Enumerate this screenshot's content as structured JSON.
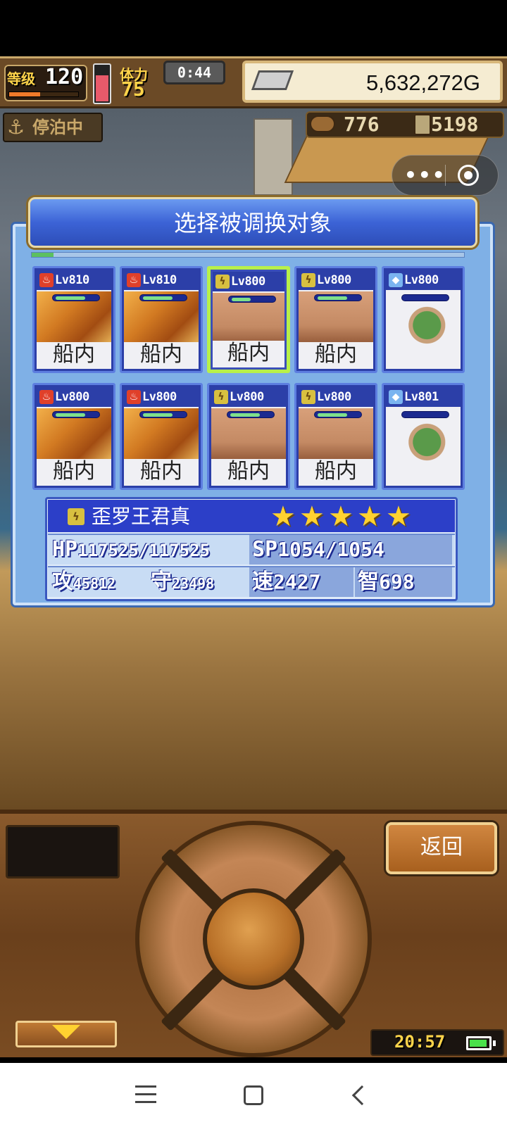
{
  "hud": {
    "level_label": "等级",
    "level_value": "120",
    "exp_fraction": 0.45,
    "stamina_label": "体力",
    "stamina_value": "75",
    "stamina_fraction": 0.85,
    "timer": "0:44",
    "gold": "5,632,272G",
    "moored_label": "停泊中",
    "wood_value": "776",
    "ore_value": "5198"
  },
  "dialog": {
    "title": "选择被调换对象",
    "progress_fraction": 0.05
  },
  "cards": [
    {
      "element": "fire",
      "level": "Lv810",
      "portrait": "dragon",
      "hp_fraction": 0.7,
      "label": "船内",
      "selected": false
    },
    {
      "element": "fire",
      "level": "Lv810",
      "portrait": "dragon",
      "hp_fraction": 0.7,
      "label": "船内",
      "selected": false
    },
    {
      "element": "thunder",
      "level": "Lv800",
      "portrait": "golem",
      "hp_fraction": 0.45,
      "label": "船内",
      "selected": true
    },
    {
      "element": "thunder",
      "level": "Lv800",
      "portrait": "golem",
      "hp_fraction": 0.7,
      "label": "船内",
      "selected": false
    },
    {
      "element": "water",
      "level": "Lv800",
      "portrait": "crab",
      "hp_fraction": 0.0,
      "label": "",
      "selected": false
    },
    {
      "element": "fire",
      "level": "Lv800",
      "portrait": "dragon",
      "hp_fraction": 0.7,
      "label": "船内",
      "selected": false
    },
    {
      "element": "fire",
      "level": "Lv800",
      "portrait": "dragon",
      "hp_fraction": 0.7,
      "label": "船内",
      "selected": false
    },
    {
      "element": "thunder",
      "level": "Lv800",
      "portrait": "golem",
      "hp_fraction": 0.7,
      "label": "船内",
      "selected": false
    },
    {
      "element": "thunder",
      "level": "Lv800",
      "portrait": "golem",
      "hp_fraction": 0.7,
      "label": "船内",
      "selected": false
    },
    {
      "element": "water",
      "level": "Lv801",
      "portrait": "crab",
      "hp_fraction": 0.0,
      "label": "",
      "selected": false
    }
  ],
  "unit": {
    "name": "歪罗王君真",
    "element": "thunder",
    "stars": 5,
    "hp_label": "HP",
    "hp_value": "117525/117525",
    "sp_label": "SP",
    "sp_value": "1054/1054",
    "atk_label": "攻",
    "atk_value": "45812",
    "def_label": "守",
    "def_value": "23498",
    "spd_label": "速",
    "spd_value": "2427",
    "int_label": "智",
    "int_value": "698"
  },
  "controls": {
    "back_label": "返回",
    "clock": "20:57"
  },
  "icons": {
    "anchor": "⚓",
    "more": "•••",
    "star": "★",
    "fire": "♨",
    "thunder": "ϟ",
    "water": "◆"
  },
  "colors": {
    "dialog_bg": "#7fb0e6",
    "card_bg": "#2c3fa8",
    "selected_border": "#b8f04a",
    "star": "#ffd230"
  }
}
